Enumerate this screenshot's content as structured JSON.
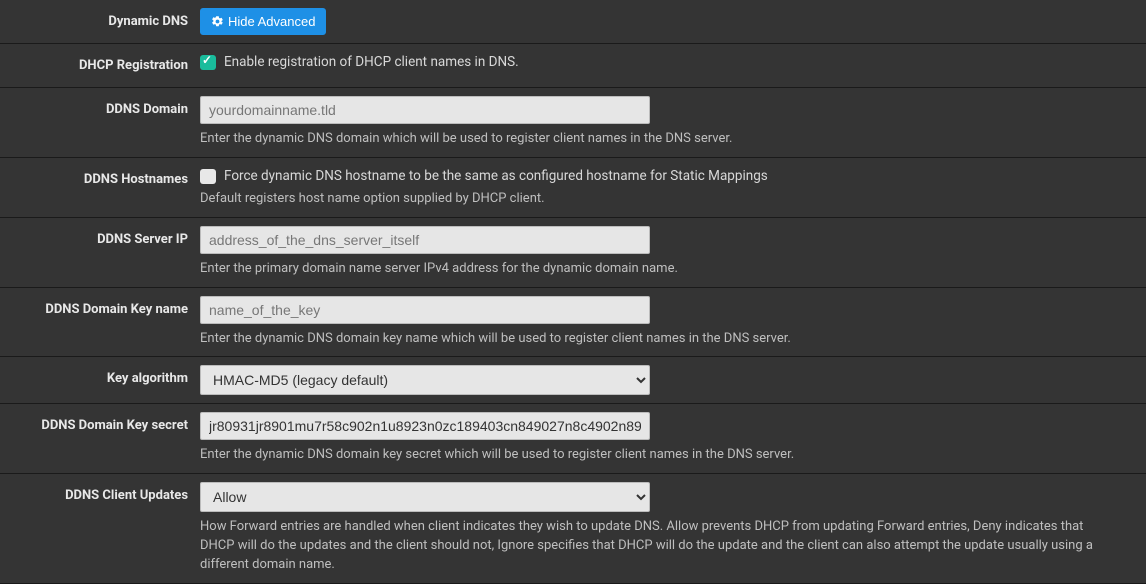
{
  "rows": {
    "dynamic_dns": {
      "label": "Dynamic DNS",
      "button": "Hide Advanced"
    },
    "dhcp_reg": {
      "label": "DHCP Registration",
      "checkbox_label": "Enable registration of DHCP client names in DNS."
    },
    "ddns_domain": {
      "label": "DDNS Domain",
      "placeholder": "yourdomainname.tld",
      "help": "Enter the dynamic DNS domain which will be used to register client names in the DNS server."
    },
    "ddns_hostnames": {
      "label": "DDNS Hostnames",
      "checkbox_label": "Force dynamic DNS hostname to be the same as configured hostname for Static Mappings",
      "help": "Default registers host name option supplied by DHCP client."
    },
    "ddns_server_ip": {
      "label": "DDNS Server IP",
      "placeholder": "address_of_the_dns_server_itself",
      "help": "Enter the primary domain name server IPv4 address for the dynamic domain name."
    },
    "ddns_key_name": {
      "label": "DDNS Domain Key name",
      "placeholder": "name_of_the_key",
      "help": "Enter the dynamic DNS domain key name which will be used to register client names in the DNS server."
    },
    "key_algo": {
      "label": "Key algorithm",
      "selected": "HMAC-MD5 (legacy default)"
    },
    "ddns_key_secret": {
      "label": "DDNS Domain Key secret",
      "value": "jr80931jr8901mu7r58c902n1u8923n0zc189403cn849027n8c4902n89",
      "help": "Enter the dynamic DNS domain key secret which will be used to register client names in the DNS server."
    },
    "ddns_client_updates": {
      "label": "DDNS Client Updates",
      "selected": "Allow",
      "help": "How Forward entries are handled when client indicates they wish to update DNS. Allow prevents DHCP from updating Forward entries, Deny indicates that DHCP will do the updates and the client should not, Ignore specifies that DHCP will do the update and the client can also attempt the update usually using a different domain name."
    }
  }
}
